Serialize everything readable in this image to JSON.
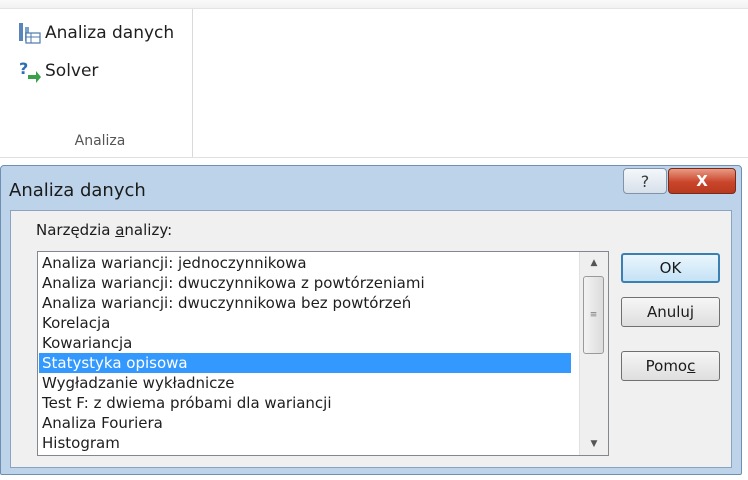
{
  "ribbon": {
    "items": [
      {
        "label": "Analiza danych",
        "icon": "data-analysis-icon"
      },
      {
        "label": "Solver",
        "icon": "solver-icon"
      }
    ],
    "group_label": "Analiza"
  },
  "dialog": {
    "title": "Analiza danych",
    "help_glyph": "?",
    "close_glyph": "X",
    "list_label_pre": "Narzędzia ",
    "list_label_accel": "a",
    "list_label_post": "nalizy:",
    "tools": [
      "Analiza wariancji: jednoczynnikowa",
      "Analiza wariancji: dwuczynnikowa z powtórzeniami",
      "Analiza wariancji: dwuczynnikowa bez powtórzeń",
      "Korelacja",
      "Kowariancja",
      "Statystyka opisowa",
      "Wygładzanie wykładnicze",
      "Test F: z dwiema próbami dla wariancji",
      "Analiza Fouriera",
      "Histogram"
    ],
    "selected_index": 5,
    "buttons": {
      "ok": "OK",
      "cancel": "Anuluj",
      "help_pre": "Pomo",
      "help_accel": "c"
    },
    "colors": {
      "selection": "#3399ff",
      "close_button": "#c9452a"
    }
  }
}
